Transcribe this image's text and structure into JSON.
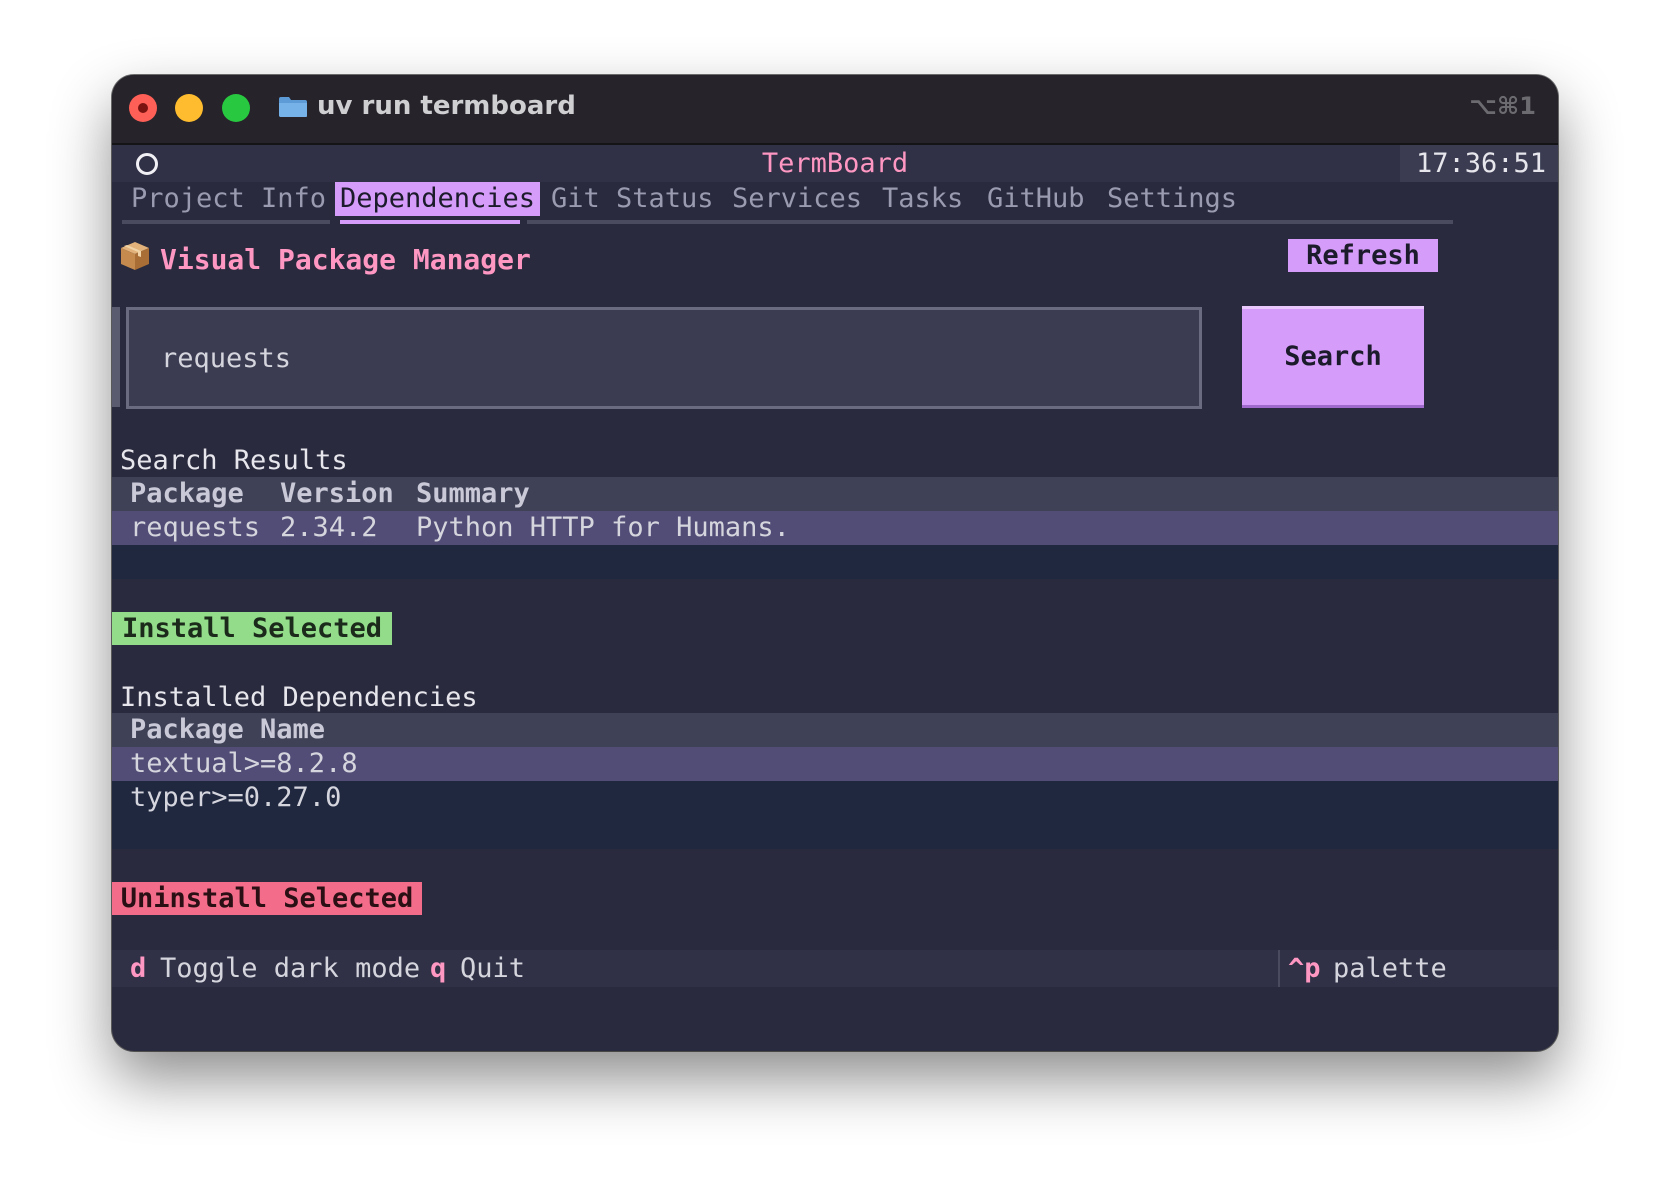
{
  "window": {
    "title": "uv run termboard",
    "shortcut": "⌥⌘1"
  },
  "header": {
    "title": "TermBoard",
    "clock": "17:36:51"
  },
  "tabs": [
    {
      "label": "Project Info",
      "active": false
    },
    {
      "label": "Dependencies",
      "active": true
    },
    {
      "label": "Git Status",
      "active": false
    },
    {
      "label": "Services",
      "active": false
    },
    {
      "label": "Tasks",
      "active": false
    },
    {
      "label": "GitHub",
      "active": false
    },
    {
      "label": "Settings",
      "active": false
    }
  ],
  "manager": {
    "title": "Visual Package Manager",
    "refresh_label": "Refresh",
    "search_value": "requests",
    "search_label": "Search"
  },
  "search_results": {
    "label": "Search Results",
    "columns": [
      "Package",
      "Version",
      "Summary"
    ],
    "rows": [
      {
        "package": "requests",
        "version": "2.34.2",
        "summary": "Python HTTP for Humans."
      }
    ],
    "install_label": "Install Selected"
  },
  "installed": {
    "label": "Installed Dependencies",
    "column": "Package Name",
    "rows": [
      "textual>=8.2.8",
      "typer>=0.27.0"
    ],
    "uninstall_label": "Uninstall Selected"
  },
  "footer": {
    "bindings": [
      {
        "key": "d",
        "desc": "Toggle dark mode"
      },
      {
        "key": "q",
        "desc": "Quit"
      }
    ],
    "palette_key": "^p",
    "palette_desc": "palette"
  },
  "colors": {
    "accent": "#d69cfa",
    "pink": "#ff97c3",
    "install": "#93dd8a",
    "uninstall": "#f36d8a"
  }
}
